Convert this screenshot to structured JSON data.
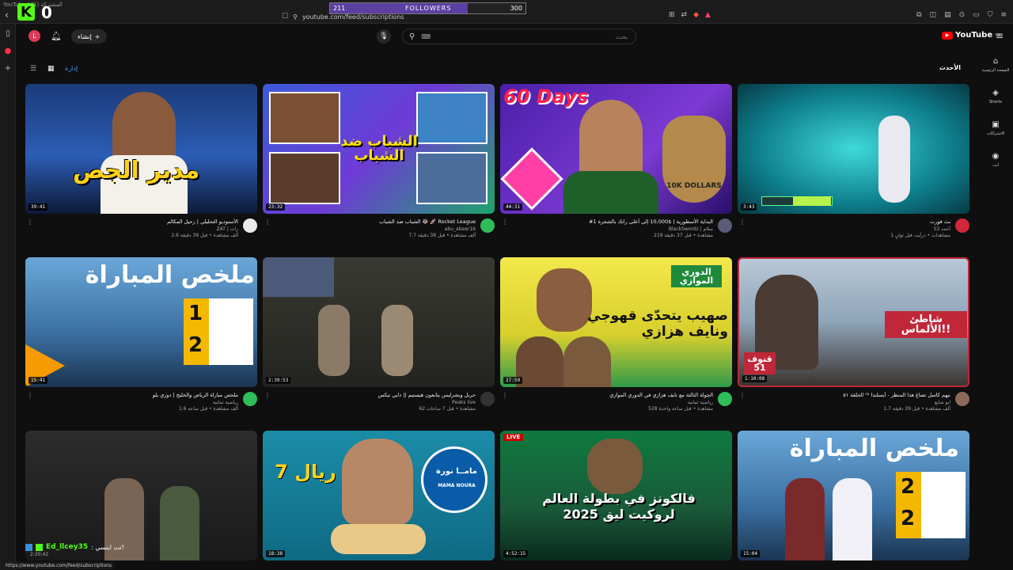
{
  "browser": {
    "tab_title": "YouTube | المشتركة (1)",
    "url": "youtube.com/feed/subscriptions",
    "status_url": "https://www.youtube.com/feed/subscriptions"
  },
  "overlay": {
    "kick_logo": "K",
    "kick_count": "0",
    "followers_current": "211",
    "followers_label": "FOLLOWERS",
    "followers_goal": "300",
    "followers_progress": 0.703
  },
  "header": {
    "avatar_letter": "L",
    "create_label": "إنشاء",
    "search_placeholder": "بحث",
    "logo_text": "YouTube",
    "logo_region": "SA"
  },
  "nav": [
    {
      "icon": "home-icon",
      "glyph": "⌂",
      "label": "الصفحة الرئيسية"
    },
    {
      "icon": "shorts-icon",
      "glyph": "◈",
      "label": "Shorts"
    },
    {
      "icon": "subscriptions-icon",
      "glyph": "▣",
      "label": "الاشتراكات"
    },
    {
      "icon": "you-icon",
      "glyph": "◉",
      "label": "أنت"
    }
  ],
  "filters": {
    "selected": "إدارة",
    "latest": "الأحدث"
  },
  "videos": [
    {
      "duration": "39:41",
      "thumb_text": "مدير الجص",
      "title": "الأستوديو التحليلي | رحيل المكالم",
      "channel": "ZAT | رات",
      "stats": "2.6 ألف مشاهدة • قبل 39 دقيقة"
    },
    {
      "duration": "23:32",
      "thumb_text": "الشباب ضد الشباب",
      "title": "الشباب ضد الشباب 😂 🚀 Rocket League",
      "channel": "abu_abeer16",
      "stats": "7.7 ألف مشاهدة • قبل 38 دقيقة"
    },
    {
      "duration": "44:31",
      "thumb_text": "60 Days",
      "thumb_text2": "10K DOLLARS",
      "title": "#1 البداية الأسطورية | $10,000 إلى أعلى رانك بالشجرة",
      "channel": "BlackSwordz | سلام",
      "stats": "219 مشاهدة • قبل 37 دقيقة"
    },
    {
      "duration": "3:43",
      "thumb_text": "",
      "title": "بث فورت",
      "channel": "أحمد 53",
      "stats": "1 مشاهدات • درأيت قبل ثوانٍ"
    },
    {
      "duration": "15:41",
      "thumb_text": "ملخص المباراة",
      "score_a": "1",
      "score_b": "2",
      "title": "ملخص مباراة الرياض والخليج | دوري يلو",
      "channel": "رياضية ثمانية",
      "stats": "1.6 ألف مشاهدة • قبل ساعة"
    },
    {
      "duration": "2:39:53",
      "thumb_text": "",
      "title": "حربل وبشرليس يتابعون هيستيم || ذايي تيكس",
      "channel": "Peaks live",
      "stats": "62 مشاهدة • قبل 7 ساعات"
    },
    {
      "duration": "27:59",
      "thumb_text": "صهيب يتحدّى قهوجي ونايف هزازي",
      "badge": "الدوري الموازي",
      "title": "الجولة الثالثة مع نايف هزازي في الدوري الموازي",
      "channel": "رياضية ثمانية",
      "stats": "528 مشاهدة • قبل ساعة واحدة"
    },
    {
      "duration": "1:10:08",
      "thumb_text": "شاطئ الألماس!!",
      "tag": "قنوف 51",
      "title": "نيهم كاسل تصاغ هذا المنظر - أيسلندا ⁰¹ الحلقة ٥١",
      "channel": "ابو شايع",
      "stats": "1.7 ألف مشاهدة • قبل 39 دقيقة"
    },
    {
      "duration": "",
      "thumb_text": "",
      "title": "",
      "channel": "",
      "stats": ""
    },
    {
      "duration": "18:38",
      "thumb_text": "7 ريال",
      "brand": "مامــا نورة",
      "brand_en": "MAMA NOURA",
      "title": "",
      "channel": "",
      "stats": ""
    },
    {
      "duration": "4:52:15",
      "thumb_text": "فالكونز في بطولة العالم لروكيت ليق 2025",
      "live": "LIVE",
      "title": "",
      "channel": "",
      "stats": ""
    },
    {
      "duration": "15:04",
      "thumb_text": "ملخص المباراة",
      "score_a": "2",
      "score_b": "2",
      "title": "",
      "channel": "",
      "stats": ""
    }
  ],
  "chat": {
    "user": "Ed_llcey35",
    "message": ": تت اينسي!",
    "time": "2:20:42"
  }
}
